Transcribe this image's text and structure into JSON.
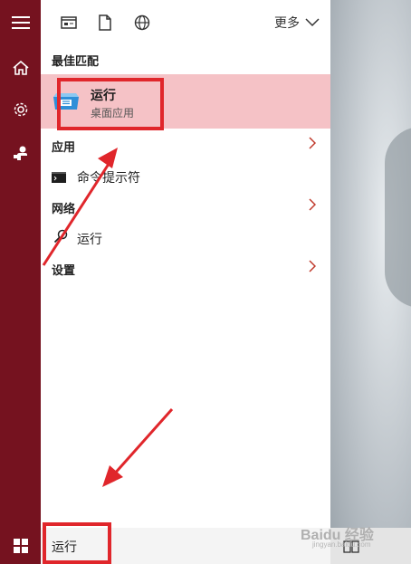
{
  "topbar": {
    "more_label": "更多"
  },
  "best_match": {
    "heading": "最佳匹配",
    "title": "运行",
    "subtitle": "桌面应用"
  },
  "sections": {
    "apps_heading": "应用",
    "apps_item": "命令提示符",
    "web_heading": "网络",
    "web_item": "运行",
    "settings_heading": "设置"
  },
  "taskbar": {
    "search_value": "运行"
  },
  "watermark": {
    "brand": "Baidu 经验",
    "url": "jingyan.baidu.com"
  },
  "colors": {
    "rail": "#75121f",
    "highlight": "#f5c2c6",
    "annotation": "#e0262b"
  }
}
